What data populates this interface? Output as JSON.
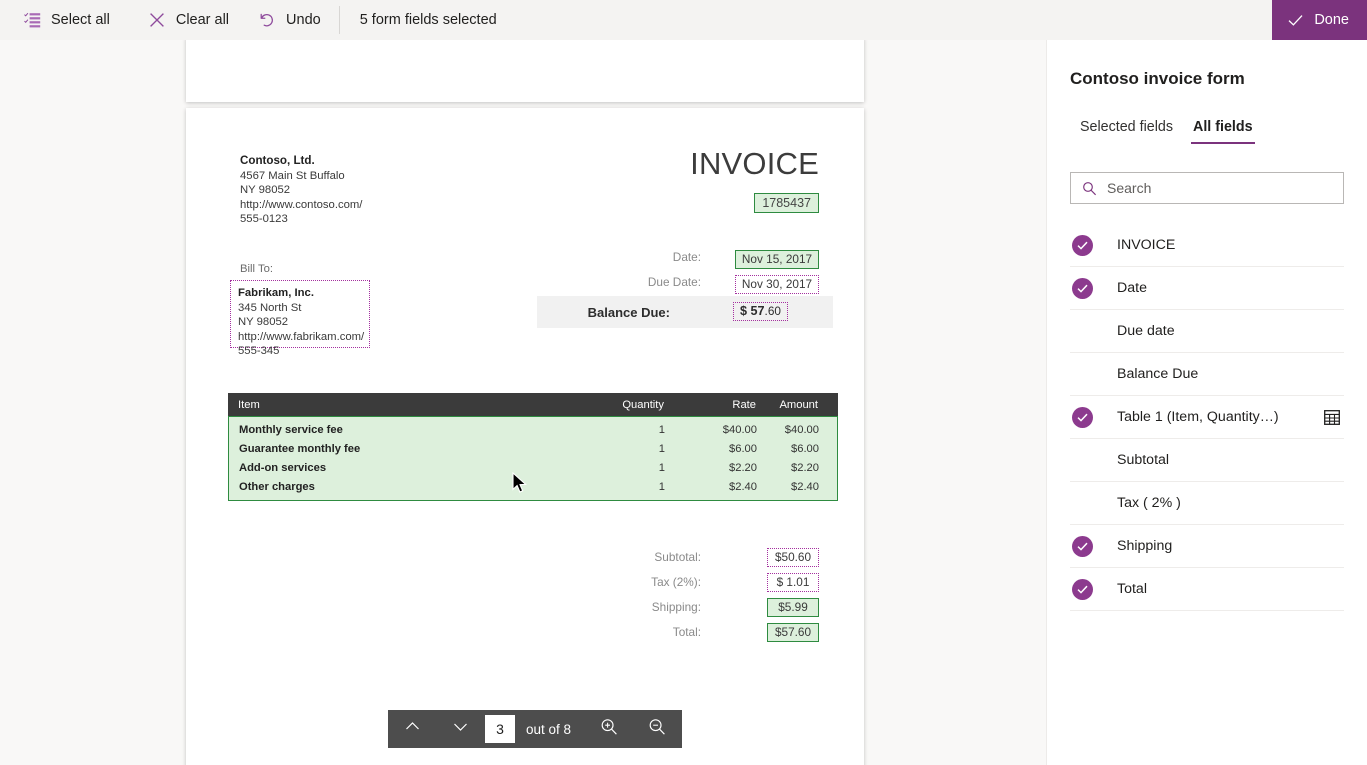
{
  "toolbar": {
    "commands": [
      {
        "label": "Select all",
        "icon": "select-all-icon"
      },
      {
        "label": "Clear all",
        "icon": "clear-all-icon"
      },
      {
        "label": "Undo",
        "icon": "undo-icon"
      }
    ],
    "status": "5 form fields selected",
    "done_label": "Done",
    "done_icon": "checkmark-icon",
    "accent_purple": "#7b337d"
  },
  "document": {
    "company": {
      "name": "Contoso, Ltd.",
      "address1": "4567 Main St Buffalo",
      "address2": "NY 98052",
      "website": "http://www.contoso.com/",
      "phone": "555-0123"
    },
    "title": "INVOICE",
    "invoice_number": "1785437",
    "bill_to_label": "Bill To:",
    "bill_to": {
      "name": "Fabrikam, Inc.",
      "address1": "345 North St",
      "address2": "NY 98052",
      "website": "http://www.fabrikam.com/",
      "phone": "555-345"
    },
    "meta": {
      "date_label": "Date:",
      "date_value": "Nov 15, 2017",
      "due_date_label": "Due Date:",
      "due_date_value": "Nov 30, 2017",
      "balance_label": "Balance Due:",
      "balance_currency": "$ 57",
      "balance_cents": ".60"
    },
    "table": {
      "headers": [
        "Item",
        "Quantity",
        "Rate",
        "Amount"
      ],
      "rows": [
        {
          "item": "Monthly service fee",
          "qty": "1",
          "rate": "$40.00",
          "amount": "$40.00"
        },
        {
          "item": "Guarantee monthly fee",
          "qty": "1",
          "rate": "$6.00",
          "amount": "$6.00"
        },
        {
          "item": "Add-on services",
          "qty": "1",
          "rate": "$2.20",
          "amount": "$2.20"
        },
        {
          "item": "Other charges",
          "qty": "1",
          "rate": "$2.40",
          "amount": "$2.40"
        }
      ]
    },
    "totals": [
      {
        "label": "Subtotal:",
        "value": "$50.60",
        "state": "dotted"
      },
      {
        "label": "Tax (2%):",
        "value": "$ 1.01",
        "state": "dotted"
      },
      {
        "label": "Shipping:",
        "value": "$5.99",
        "state": "green"
      },
      {
        "label": "Total:",
        "value": "$57.60",
        "state": "green"
      }
    ],
    "selection_colors": {
      "selected_fill": "#ddf0dc",
      "selected_border": "#2e8b40",
      "candidate_border": "#a4309f"
    }
  },
  "page_nav": {
    "up_icon": "chevron-up-icon",
    "down_icon": "chevron-down-icon",
    "current_page": "3",
    "out_of": "out of 8",
    "zoom_in_icon": "zoom-in-icon",
    "zoom_out_icon": "zoom-out-icon"
  },
  "panel": {
    "title": "Contoso invoice form",
    "tabs": [
      {
        "label": "Selected fields",
        "active": false
      },
      {
        "label": "All fields",
        "active": true
      }
    ],
    "search": {
      "placeholder": "Search",
      "value": "",
      "icon": "search-icon"
    },
    "fields": [
      {
        "label": "INVOICE",
        "checked": true,
        "icon": null
      },
      {
        "label": "Date",
        "checked": true,
        "icon": null
      },
      {
        "label": "Due date",
        "checked": false,
        "icon": null
      },
      {
        "label": "Balance Due",
        "checked": false,
        "icon": null
      },
      {
        "label": "Table 1 (Item, Quantity…)",
        "checked": true,
        "icon": "table-icon"
      },
      {
        "label": "Subtotal",
        "checked": false,
        "icon": null
      },
      {
        "label": "Tax ( 2% )",
        "checked": false,
        "icon": null
      },
      {
        "label": "Shipping",
        "checked": true,
        "icon": null
      },
      {
        "label": "Total",
        "checked": true,
        "icon": null
      }
    ]
  }
}
